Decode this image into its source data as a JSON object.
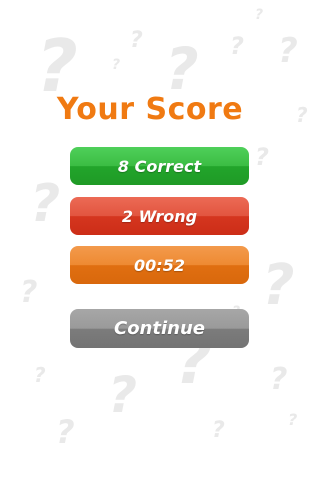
{
  "screen": {
    "title": "Your Score",
    "accent_color": "#f07a12"
  },
  "results": {
    "correct_label": "8 Correct",
    "wrong_label": "2 Wrong",
    "time_label": "00:52"
  },
  "actions": {
    "continue_label": "Continue"
  },
  "colors": {
    "correct": "#2fb43a",
    "wrong": "#db4128",
    "time": "#e9801f",
    "continue": "#8a8a8a",
    "background_marks": "#e9e9e9"
  },
  "background": {
    "mark_glyph": "?"
  }
}
